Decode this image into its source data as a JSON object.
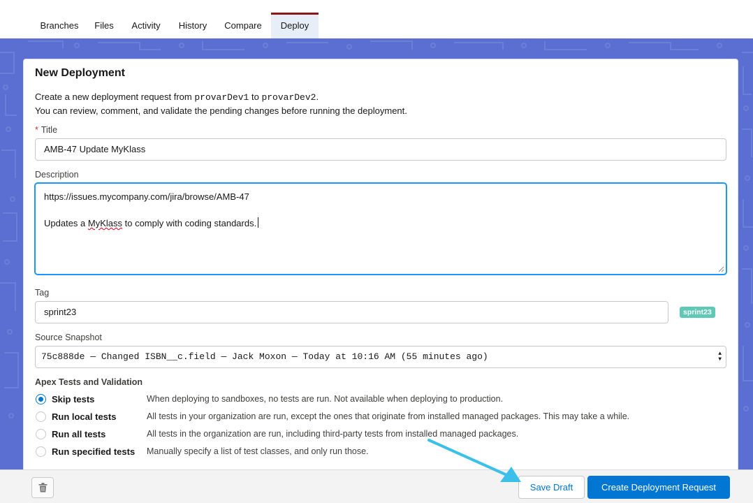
{
  "tabs": [
    {
      "label": "Branches"
    },
    {
      "label": "Files"
    },
    {
      "label": "Activity"
    },
    {
      "label": "History"
    },
    {
      "label": "Compare"
    },
    {
      "label": "Deploy",
      "active": true
    }
  ],
  "card": {
    "title": "New Deployment",
    "intro": {
      "line1_prefix": "Create a new deployment request from ",
      "source": "provarDev1",
      "line1_mid": " to ",
      "target": "provarDev2",
      "line1_suffix": ".",
      "line2": "You can review, comment, and validate the pending changes before running the deployment."
    }
  },
  "form": {
    "title_label": "Title",
    "title_required_mark": "*",
    "title_value": "AMB-47 Update MyKlass",
    "description_label": "Description",
    "description_line1": "https://issues.mycompany.com/jira/browse/AMB-47",
    "description_line3_prefix": "Updates a ",
    "description_line3_misspelled": "MyKlass",
    "description_line3_suffix": " to comply with coding standards.",
    "tag_label": "Tag",
    "tag_value": "sprint23",
    "tag_badge": "sprint23",
    "snapshot_label": "Source Snapshot",
    "snapshot_value": "75c888de — Changed ISBN__c.field — Jack Moxon — Today at 10:16 AM (55 minutes ago)"
  },
  "tests": {
    "heading": "Apex Tests and Validation",
    "selected": "Skip tests",
    "options": [
      {
        "label": "Skip tests",
        "description": "When deploying to sandboxes, no tests are run. Not available when deploying to production."
      },
      {
        "label": "Run local tests",
        "description": "All tests in your organization are run, except the ones that originate from installed managed packages. This may take a while."
      },
      {
        "label": "Run all tests",
        "description": "All tests in the organization are run, including third-party tests from installed managed packages."
      },
      {
        "label": "Run specified tests",
        "description": "Manually specify a list of test classes, and only run those."
      }
    ]
  },
  "footer": {
    "delete_icon": "trash-icon",
    "save_draft_label": "Save Draft",
    "create_label": "Create Deployment Request"
  },
  "colors": {
    "brand": "#0176d3",
    "active_tab_border": "#8a1a1a",
    "backdrop": "#5a6fd1",
    "tag_badge": "#5fc9b5",
    "annotation_arrow": "#3cc0ea"
  }
}
